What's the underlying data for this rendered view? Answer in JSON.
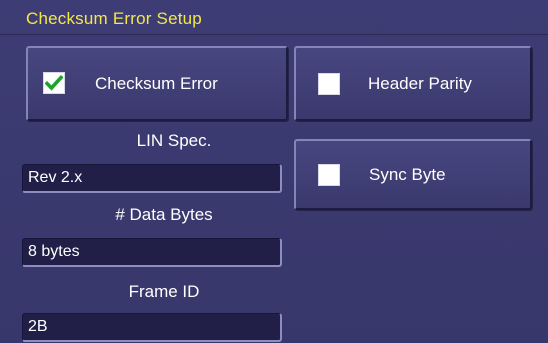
{
  "title": "Checksum Error Setup",
  "toggles": {
    "checksum_error": {
      "label": "Checksum Error",
      "checked": true
    },
    "header_parity": {
      "label": "Header Parity",
      "checked": false
    },
    "sync_byte": {
      "label": "Sync Byte",
      "checked": false
    }
  },
  "fields": {
    "lin_spec": {
      "label": "LIN Spec.",
      "value": "Rev 2.x"
    },
    "data_bytes": {
      "label": "# Data Bytes",
      "value": "8 bytes"
    },
    "frame_id": {
      "label": "Frame ID",
      "value": "2B"
    }
  },
  "colors": {
    "background": "#3b3a70",
    "title_text": "#f2e84a",
    "check_mark": "#1fa22a",
    "field_background": "#211f47"
  },
  "icons": {
    "checksum_error": "check-icon"
  }
}
